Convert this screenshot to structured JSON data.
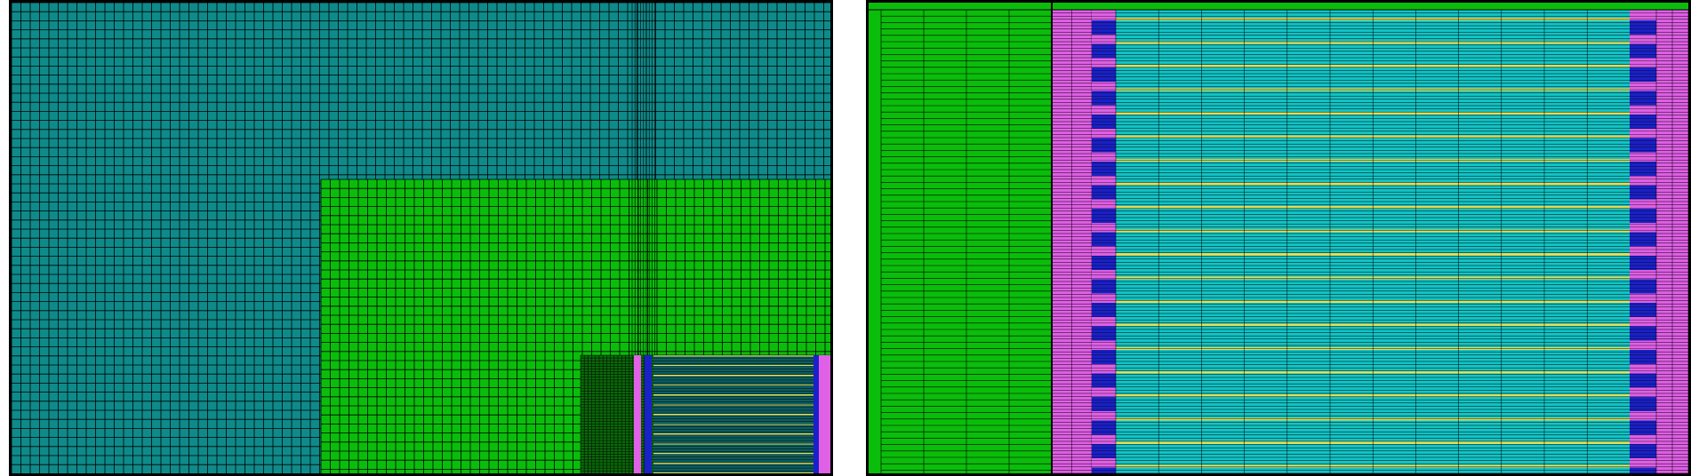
{
  "figure": {
    "panels": [
      {
        "id": "coarse-mesh-overview",
        "regions": [
          "outer-domain",
          "intermediate-refinement",
          "fine-core-region"
        ]
      },
      {
        "id": "core-mesh-detail",
        "regions": [
          "reflector",
          "gap-layers",
          "fuel-channel-stack",
          "gap-layers",
          "outer-edge"
        ]
      }
    ]
  },
  "colors": {
    "outer_domain": "#0f8a8a",
    "refinement": "#0bbd0b",
    "pink_layer": "#e060e6",
    "blue_block": "#1b21c8",
    "cyan_channel": "#12c4c6",
    "yellow_stripe": "#e3e05a",
    "grid_line": "#000000",
    "background": "#ffffff"
  }
}
